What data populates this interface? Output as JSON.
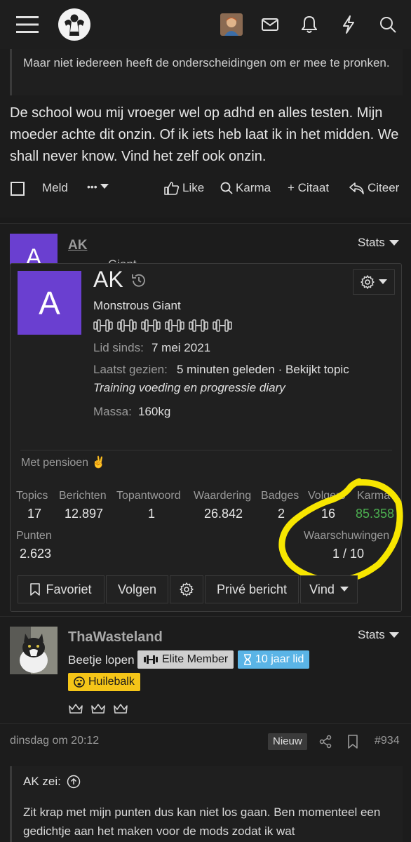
{
  "topbar": {
    "icons": [
      "menu-icon",
      "logo",
      "user-avatar",
      "mail-icon",
      "bell-icon",
      "bolt-icon",
      "search-icon"
    ]
  },
  "post1": {
    "quote_text": "Maar niet iedereen heeft de onderscheidingen om er mee te pronken.",
    "body": "De school wou mij vroeger wel op adhd en alles testen. Mijn moeder achte dit onzin. Of ik iets heb laat ik in het midden. We shall never know. Vind het zelf ook onzin.",
    "actions": {
      "meld": "Meld",
      "more": "•••",
      "like": "Like",
      "karma": "Karma",
      "citaat": "+ Citaat",
      "citeer": "Citeer"
    }
  },
  "post2": {
    "avatar_letter": "A",
    "username": "AK",
    "stats_label": "Stats",
    "behind_text": "Giant"
  },
  "card": {
    "avatar_letter": "A",
    "username": "AK",
    "title": "Monstrous Giant",
    "dumbbell_count": 6,
    "member_since_label": "Lid sinds:",
    "member_since_value": "7 mei 2021",
    "last_seen_label": "Laatst gezien:",
    "last_seen_value": "5 minuten geleden · Bekijkt topic",
    "last_seen_topic": "Training voeding en progressie diary",
    "massa_label": "Massa:",
    "massa_value": "160kg",
    "status": "Met pensioen ✌️",
    "stats": [
      {
        "label": "Topics",
        "value": "17"
      },
      {
        "label": "Berichten",
        "value": "12.897"
      },
      {
        "label": "Topantwoord",
        "value": "1"
      },
      {
        "label": "Waardering",
        "value": "26.842"
      },
      {
        "label": "Badges",
        "value": "2"
      },
      {
        "label": "Volgers",
        "value": "16"
      },
      {
        "label": "Karma",
        "value": "85.358"
      }
    ],
    "punten_label": "Punten",
    "punten_value": "2.623",
    "waarschuwingen_label": "Waarschuwingen",
    "waarschuwingen_value": "1 / 10",
    "buttons": {
      "favoriet": "Favoriet",
      "volgen": "Volgen",
      "prive": "Privé bericht",
      "vind": "Vind"
    },
    "karma_color": "#4caf50",
    "highlight_color": "#f7e600"
  },
  "post3": {
    "username": "ThaWasteland",
    "stats_label": "Stats",
    "subtitle": "Beetje lopen",
    "badges": {
      "elite": "Elite Member",
      "years": "10 jaar lid",
      "huilebalk": "Huilebalk"
    },
    "crown_count": 3,
    "date": "dinsdag om 20:12",
    "new_label": "Nieuw",
    "post_number": "#934",
    "quote_author": "AK zei:",
    "quote_text": "Zit krap met mijn punten dus kan niet los gaan. Ben momenteel een gedichtje aan het maken voor de mods zodat ik wat"
  }
}
